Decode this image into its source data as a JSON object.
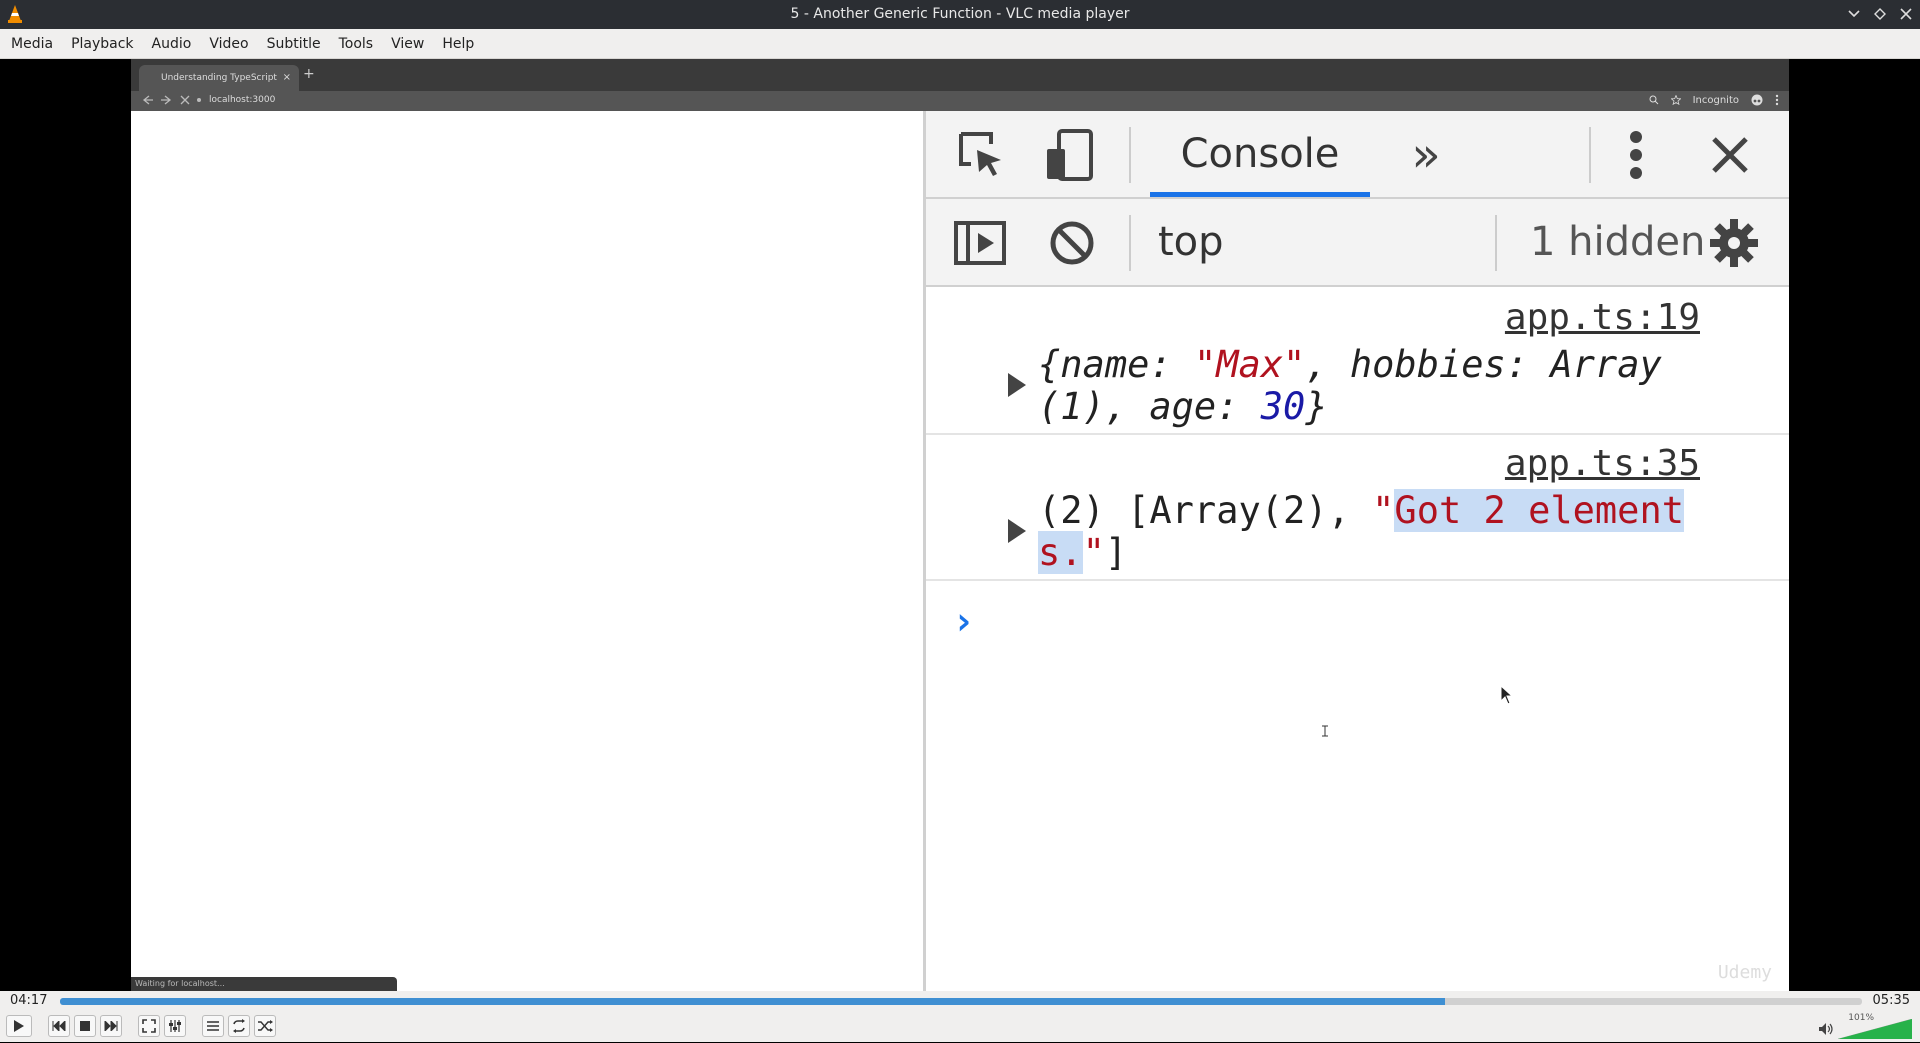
{
  "window": {
    "title": "5 - Another Generic Function - VLC media player"
  },
  "menu": [
    "Media",
    "Playback",
    "Audio",
    "Video",
    "Subtitle",
    "Tools",
    "View",
    "Help"
  ],
  "browser": {
    "tab_title": "Understanding TypeScript",
    "tab_close": "×",
    "new_tab": "+",
    "url": "localhost:3000",
    "incognito_label": "Incognito",
    "status_text": "Waiting for localhost..."
  },
  "devtools": {
    "tab_label": "Console",
    "more_tabs": "»",
    "context": "top",
    "hidden_count": "1 hidden",
    "messages": [
      {
        "source": "app.ts:19",
        "line1": [
          {
            "t": "{name: ",
            "c": ""
          },
          {
            "t": "\"Max\"",
            "c": "str"
          },
          {
            "t": ", hobbies: Array",
            "c": ""
          }
        ],
        "line2": [
          {
            "t": "(1), age: ",
            "c": ""
          },
          {
            "t": "30",
            "c": "num"
          },
          {
            "t": "}",
            "c": ""
          }
        ]
      },
      {
        "source": "app.ts:35",
        "line1": [
          {
            "t": "(2) [Array(2), ",
            "c": ""
          },
          {
            "t": "\"",
            "c": "str"
          },
          {
            "t": "Got 2 element",
            "c": "str hl"
          }
        ],
        "line2": [
          {
            "t": "s.",
            "c": "str hl"
          },
          {
            "t": "\"",
            "c": "str"
          },
          {
            "t": "]",
            "c": ""
          }
        ]
      }
    ],
    "prompt": "›",
    "watermark": "Udemy"
  },
  "player": {
    "elapsed": "04:17",
    "total": "05:35",
    "progress": 0.7686,
    "volume_label": "101%",
    "volume": 1.01
  },
  "colors": {
    "seek_fill": "#3f8fd2",
    "volume_fill": "#27b24a",
    "devtools_accent": "#1a73e8"
  }
}
